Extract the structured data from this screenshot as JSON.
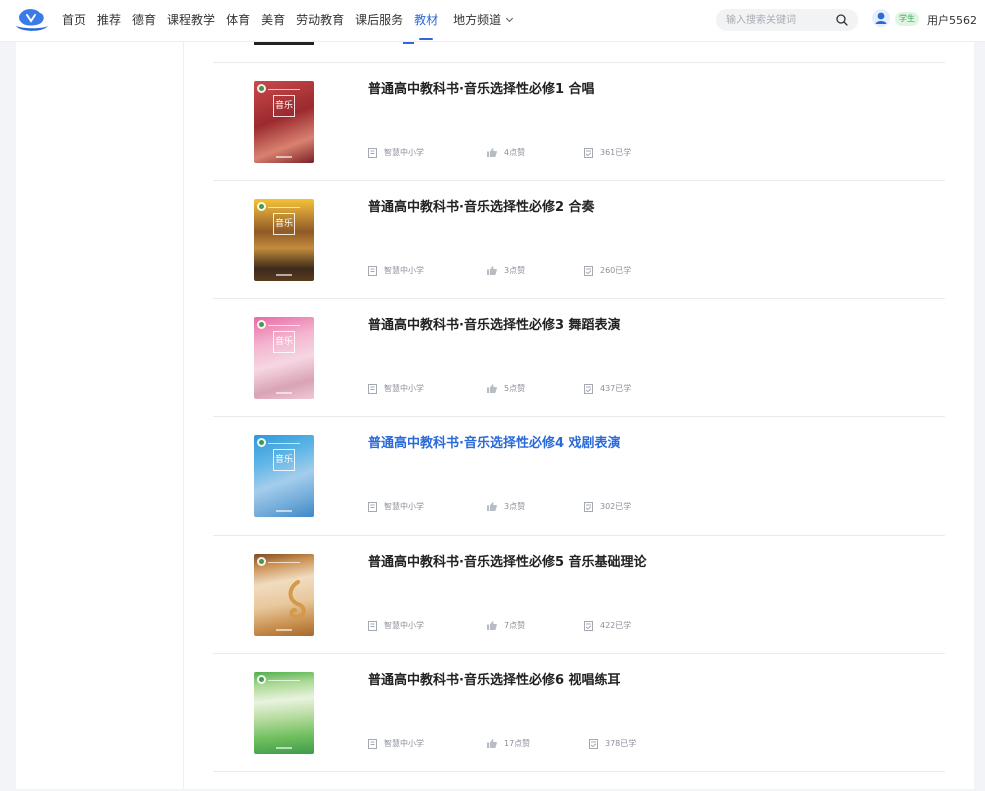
{
  "nav": {
    "items": [
      "首页",
      "推荐",
      "德育",
      "课程教学",
      "体育",
      "美育",
      "劳动教育",
      "课后服务",
      "教材"
    ],
    "active_index": 8,
    "dropdown_label": "地方频道"
  },
  "search": {
    "placeholder": "输入搜索关键词"
  },
  "user": {
    "role_badge": "学生",
    "name": "用户5562"
  },
  "books": [
    {
      "title": "普通高中教科书·音乐选择性必修1 合唱",
      "publisher": "智慧中小学",
      "likes": "4点赞",
      "learners": "361已学",
      "cover_char": "音乐",
      "highlighted": false
    },
    {
      "title": "普通高中教科书·音乐选择性必修2 合奏",
      "publisher": "智慧中小学",
      "likes": "3点赞",
      "learners": "260已学",
      "cover_char": "音乐",
      "highlighted": false
    },
    {
      "title": "普通高中教科书·音乐选择性必修3 舞蹈表演",
      "publisher": "智慧中小学",
      "likes": "5点赞",
      "learners": "437已学",
      "cover_char": "音乐",
      "highlighted": false
    },
    {
      "title": "普通高中教科书·音乐选择性必修4 戏剧表演",
      "publisher": "智慧中小学",
      "likes": "3点赞",
      "learners": "302已学",
      "cover_char": "音乐",
      "highlighted": true
    },
    {
      "title": "普通高中教科书·音乐选择性必修5 音乐基础理论",
      "publisher": "智慧中小学",
      "likes": "7点赞",
      "learners": "422已学",
      "cover_char": "",
      "highlighted": false
    },
    {
      "title": "普通高中教科书·音乐选择性必修6 视唱练耳",
      "publisher": "智慧中小学",
      "likes": "17点赞",
      "learners": "378已学",
      "cover_char": "",
      "highlighted": false
    }
  ],
  "colors": {
    "accent": "#2b6ad9",
    "badge_bg": "#dff5e1",
    "badge_text": "#3aa85a"
  }
}
